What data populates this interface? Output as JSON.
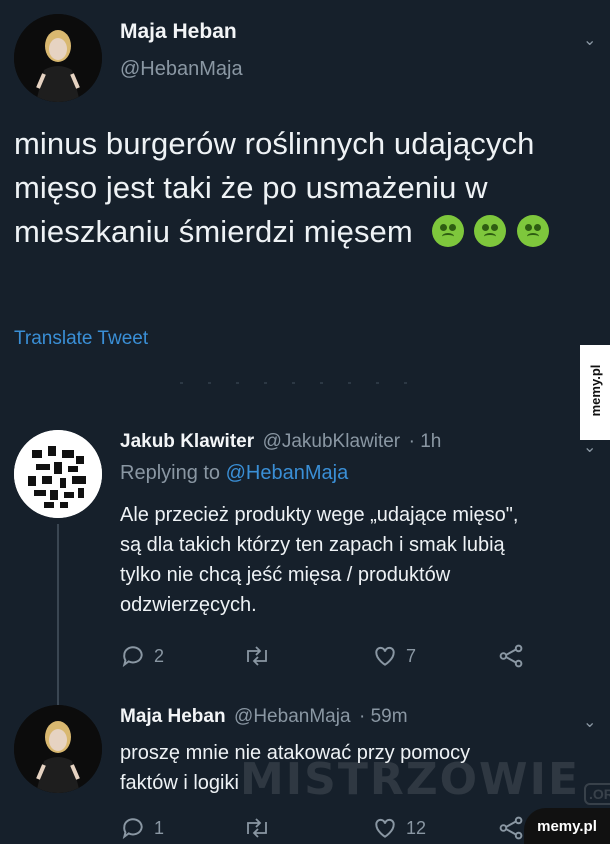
{
  "tweet": {
    "author_name": "Maja Heban",
    "author_handle": "@HebanMaja",
    "text": "minus burgerów roślinnych udających mięso jest taki że po usmażeniu w mieszkaniu śmierdzi mięsem",
    "emoji": [
      "nauseated-face",
      "nauseated-face",
      "nauseated-face"
    ],
    "translate_label": "Translate Tweet"
  },
  "reply1": {
    "author_name": "Jakub Klawiter",
    "author_handle": "@JakubKlawiter",
    "time": "· 1h",
    "replying_prefix": "Replying to",
    "replying_handle": "@HebanMaja",
    "text_lines": [
      "Ale przecież produkty wege „udające mięso\",",
      "są dla takich którzy ten zapach i smak lubią",
      "tylko nie chcą jeść mięsa / produktów",
      "odzwierzęcych."
    ],
    "reply_count": "2",
    "like_count": "7"
  },
  "reply2": {
    "author_name": "Maja Heban",
    "author_handle": "@HebanMaja",
    "time": "· 59m",
    "text_lines": [
      "proszę mnie nie atakować przy pomocy",
      "faktów i logiki"
    ],
    "reply_count": "1",
    "like_count": "12"
  },
  "watermarks": {
    "side": "memy.pl",
    "badge": "memy.pl",
    "overlay": "MISTRZOWIE",
    "overlay_suffix": ".ORG"
  },
  "colors": {
    "background": "#16202b",
    "link": "#3a8fd6",
    "muted": "#8a97a3"
  }
}
